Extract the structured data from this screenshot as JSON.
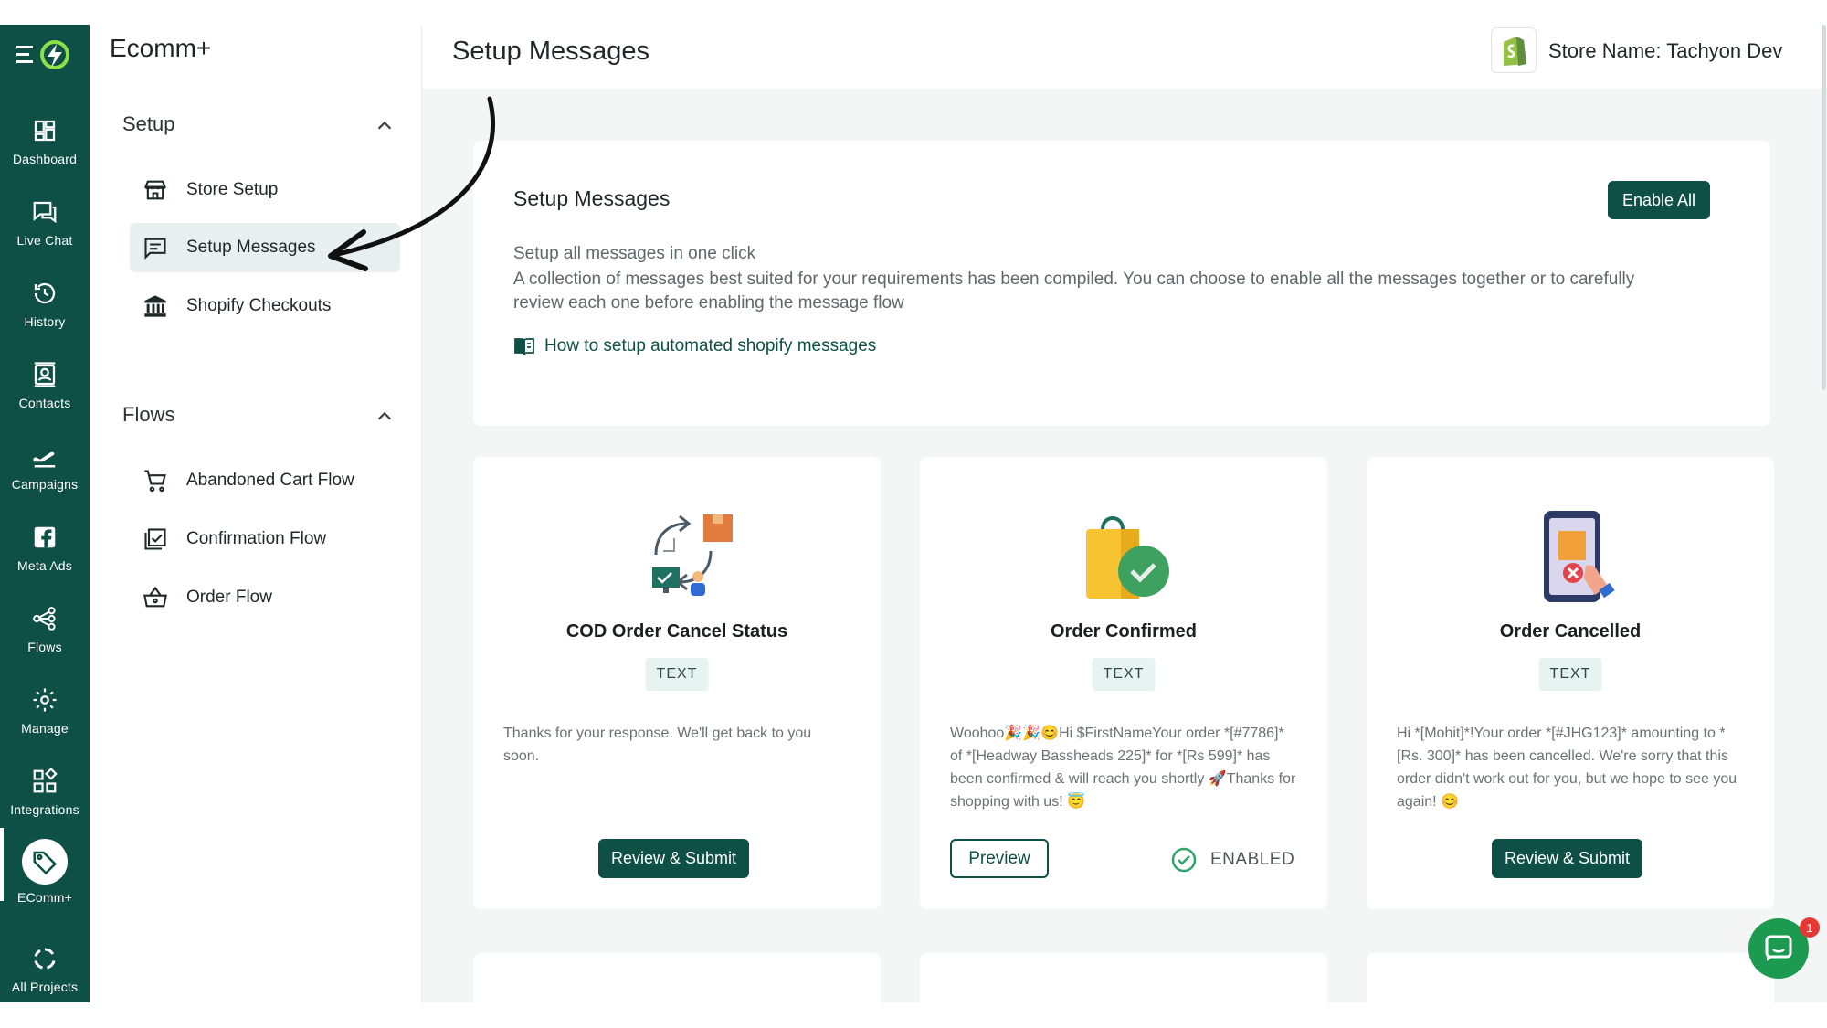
{
  "rail": {
    "items": [
      {
        "label": "Dashboard",
        "icon": "dashboard-icon"
      },
      {
        "label": "Live Chat",
        "icon": "chat-icon"
      },
      {
        "label": "History",
        "icon": "history-icon"
      },
      {
        "label": "Contacts",
        "icon": "contacts-icon"
      },
      {
        "label": "Campaigns",
        "icon": "plane-icon"
      },
      {
        "label": "Meta Ads",
        "icon": "facebook-icon"
      },
      {
        "label": "Flows",
        "icon": "flows-icon"
      },
      {
        "label": "Manage",
        "icon": "gear-icon"
      },
      {
        "label": "Integrations",
        "icon": "integrations-icon"
      },
      {
        "label": "EComm+",
        "icon": "tag-icon"
      },
      {
        "label": "All Projects",
        "icon": "projects-icon"
      }
    ]
  },
  "sidebar": {
    "title": "Ecomm+",
    "setup": {
      "label": "Setup",
      "items": [
        {
          "label": "Store Setup",
          "icon": "store-icon"
        },
        {
          "label": "Setup Messages",
          "icon": "message-icon"
        },
        {
          "label": "Shopify Checkouts",
          "icon": "bank-icon"
        }
      ]
    },
    "flows": {
      "label": "Flows",
      "items": [
        {
          "label": "Abandoned Cart Flow",
          "icon": "cart-icon"
        },
        {
          "label": "Confirmation Flow",
          "icon": "checklist-icon"
        },
        {
          "label": "Order Flow",
          "icon": "basket-icon"
        }
      ]
    }
  },
  "header": {
    "title": "Setup Messages",
    "store_name": "Store Name: Tachyon Dev"
  },
  "panel": {
    "title": "Setup Messages",
    "enable_all": "Enable All",
    "subtitle": "Setup all messages in one click",
    "description": "A collection of messages best suited for your requirements has been compiled. You can choose to enable all the messages together or to carefully review each one before enabling the message flow",
    "link": "How to setup automated shopify messages"
  },
  "cards": [
    {
      "title": "COD Order Cancel Status",
      "badge": "TEXT",
      "message": "Thanks for your response. We'll get back to you soon.",
      "button": "Review & Submit"
    },
    {
      "title": "Order Confirmed",
      "badge": "TEXT",
      "message": "Woohoo🎉🎉😊Hi $FirstNameYour order *[#7786]* of *[Headway Bassheads 225]* for *[Rs 599]* has been confirmed & will reach you shortly 🚀Thanks for shopping with us! 😇",
      "button": "Preview",
      "status": "ENABLED"
    },
    {
      "title": "Order Cancelled",
      "badge": "TEXT",
      "message": "Hi *[Mohit]*!Your order *[#JHG123]* amounting to *[Rs. 300]* has been cancelled. We're sorry that this order didn't work out for you, but we hope to see you again! 😊",
      "button": "Review & Submit"
    }
  ],
  "chat": {
    "badge": "1"
  },
  "colors": {
    "brand": "#0e4f46",
    "background": "#f4f5f5",
    "badge_bg": "#e6f3f0",
    "success": "#1b9a50"
  }
}
